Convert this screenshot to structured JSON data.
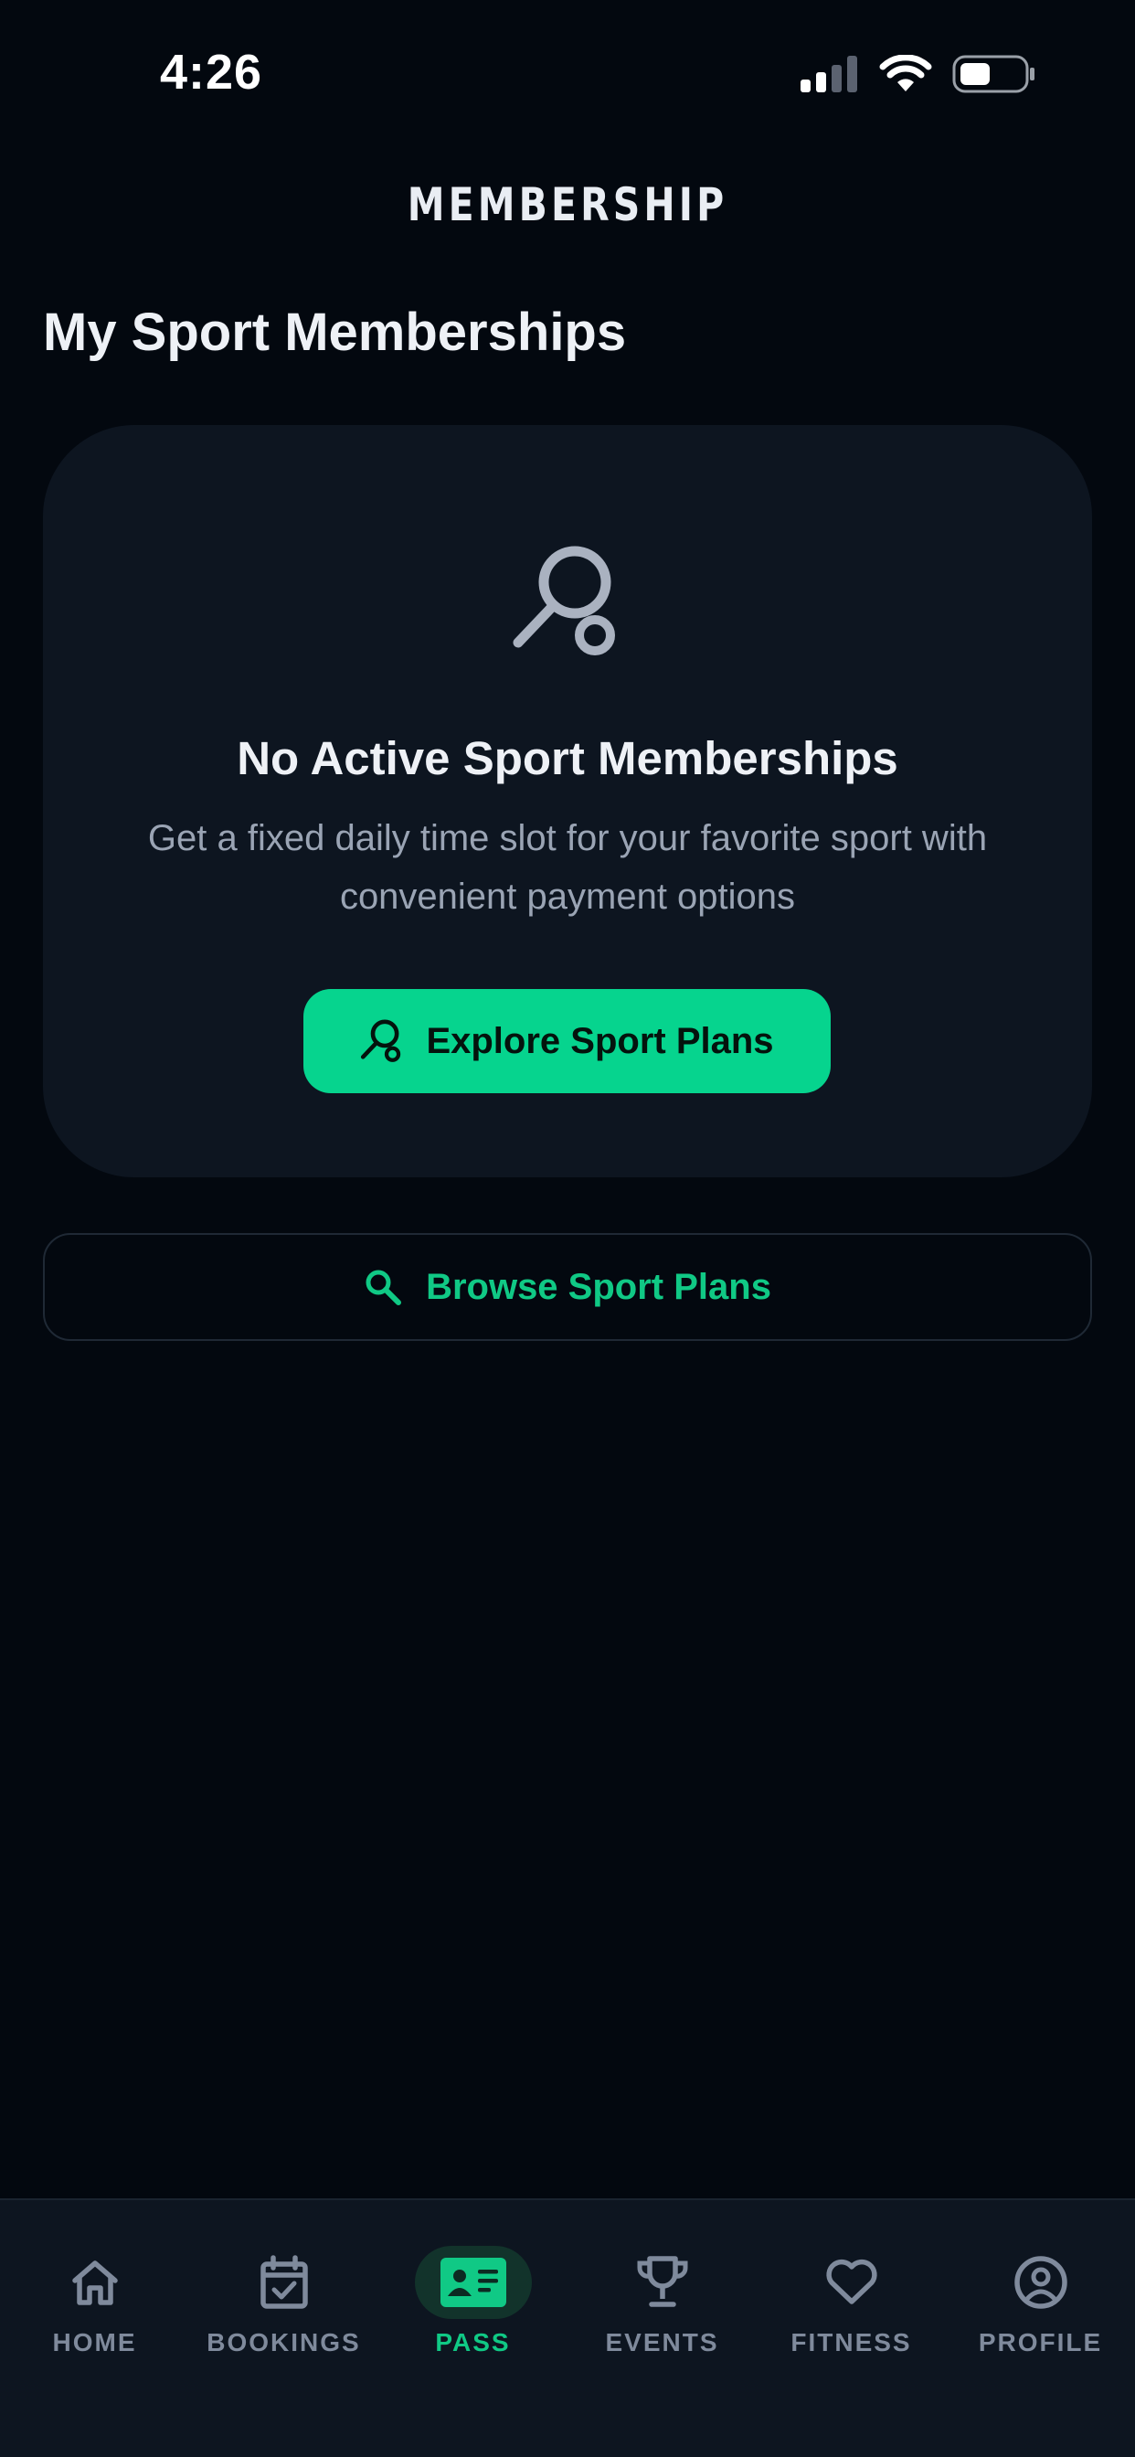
{
  "status_bar": {
    "time": "4:26"
  },
  "header": {
    "title": "MEMBERSHIP"
  },
  "section": {
    "title": "My Sport Memberships"
  },
  "empty_state": {
    "icon": "tennis-racket-icon",
    "heading": "No Active Sport Memberships",
    "subtitle": "Get a fixed daily time slot for your favorite sport with convenient payment options",
    "primary_button_label": "Explore Sport Plans"
  },
  "browse": {
    "label": "Browse Sport Plans",
    "icon": "search-icon"
  },
  "tab_bar": {
    "active_tab": "PASS",
    "tabs": [
      {
        "label": "HOME",
        "icon": "home-icon"
      },
      {
        "label": "BOOKINGS",
        "icon": "calendar-check-icon"
      },
      {
        "label": "PASS",
        "icon": "id-card-icon"
      },
      {
        "label": "EVENTS",
        "icon": "trophy-icon"
      },
      {
        "label": "FITNESS",
        "icon": "heart-icon"
      },
      {
        "label": "PROFILE",
        "icon": "user-circle-icon"
      }
    ]
  },
  "colors": {
    "background": "#03080f",
    "card": "#0d1520",
    "accent": "#06d48e",
    "accent_text": "#10c985",
    "muted_text": "#9aa4b4",
    "tab_inactive": "#7f8a9c"
  }
}
